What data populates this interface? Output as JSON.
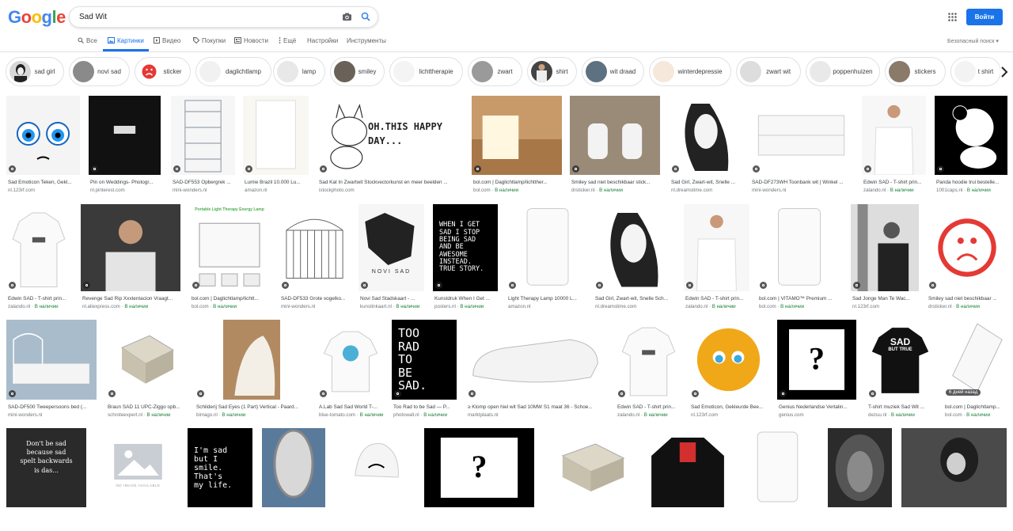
{
  "header": {
    "logo": "Google",
    "logo_colors": [
      "#4285f4",
      "#ea4335",
      "#fbbc05",
      "#4285f4",
      "#34a853",
      "#ea4335"
    ],
    "query": "Sad Wit",
    "signin_label": "Войти",
    "safesearch_label": "Безопасный поиск ▾"
  },
  "nav": {
    "tabs": [
      {
        "label": "Все",
        "icon": "search-icon"
      },
      {
        "label": "Картинки",
        "icon": "image-icon",
        "active": true
      },
      {
        "label": "Видео",
        "icon": "video-icon"
      },
      {
        "label": "Покупки",
        "icon": "tag-icon"
      },
      {
        "label": "Новости",
        "icon": "news-icon"
      },
      {
        "label": "Ещё",
        "icon": "more-icon"
      },
      {
        "label": "Настройки"
      },
      {
        "label": "Инструменты"
      }
    ]
  },
  "chips": [
    {
      "label": "sad girl"
    },
    {
      "label": "novi sad"
    },
    {
      "label": "sticker"
    },
    {
      "label": "daglichtlamp"
    },
    {
      "label": "lamp"
    },
    {
      "label": "smiley"
    },
    {
      "label": "lichttherapie"
    },
    {
      "label": "zwart"
    },
    {
      "label": "shirt"
    },
    {
      "label": "wit draad"
    },
    {
      "label": "winterdepressie"
    },
    {
      "label": "zwart wit"
    },
    {
      "label": "poppenhuizen"
    },
    {
      "label": "stickers"
    },
    {
      "label": "t shirt"
    }
  ],
  "grid": {
    "stock_label": "В наличии",
    "rows": [
      [
        {
          "cap": "Sad Emoticon Teken, Gekl...",
          "src": "nl.123rf.com",
          "stock": false
        },
        {
          "cap": "Pin on Weddings- Photogr...",
          "src": "nl.pinterest.com",
          "stock": false
        },
        {
          "cap": "SAD-DF553 Opbergrek ...",
          "src": "mini-wonders.nl",
          "stock": false
        },
        {
          "cap": "Lumie Brazil 10.000 Lu...",
          "src": "amazon.nl",
          "stock": false
        },
        {
          "cap": "Sad Kat In Zwartwit Stockvectorkunst en meer beelden ...",
          "src": "istockphoto.com",
          "stock": false,
          "sign": "OH.THIS HAPPY DAY..."
        },
        {
          "cap": "bol.com | Daglichtlamp/lichtther...",
          "src": "bol.com",
          "stock": true
        },
        {
          "cap": "Smiley sad niet beschikbaar stick...",
          "src": "drsticker.nl",
          "stock": true
        },
        {
          "cap": "Sad Girl, Zwart-wit, Snelle ...",
          "src": "nl.dreamstime.com",
          "stock": false
        },
        {
          "cap": "SAD-DF273WH Toonbank wit | Winkel ...",
          "src": "mini-wonders.nl",
          "stock": false
        },
        {
          "cap": "Edwin SAD - T-shirt prin...",
          "src": "zalando.nl",
          "stock": true
        },
        {
          "cap": "Panda hoodie trui bestelle...",
          "src": "1001caps.nl",
          "stock": true
        }
      ],
      [
        {
          "cap": "Edwin SAD - T-shirt prin...",
          "src": "zalando.nl",
          "stock": true
        },
        {
          "cap": "Revenge Sad Rip Xxxtentacion Vraagt...",
          "src": "nl.aliexpress.com",
          "stock": true
        },
        {
          "cap": "bol.com | Daglichtlamp/lichtt...",
          "src": "bol.com",
          "stock": true,
          "banner": "Portable Light Therapy Energy Lamp"
        },
        {
          "cap": "SAD-DF533 Grote vogelko...",
          "src": "mini-wonders.nl",
          "stock": false
        },
        {
          "cap": "Novi Sad Stadskaart - ...",
          "src": "kunstinkaart.nl",
          "stock": true,
          "maptitle": "NOVI SAD"
        },
        {
          "cap": "Kunstdruk When I Get ...",
          "src": "posters.nl",
          "stock": true,
          "poster": [
            "WHEN I GET",
            "SAD I STOP",
            "BEING SAD",
            "AND BE",
            "AWESOME",
            "INSTEAD.",
            "TRUE STORY."
          ]
        },
        {
          "cap": "Light Therapy Lamp 10000 L...",
          "src": "amazon.nl",
          "stock": false
        },
        {
          "cap": "Sad Girl, Zwart-wit, Snelle Sch...",
          "src": "nl.dreamstime.com",
          "stock": false
        },
        {
          "cap": "Edwin SAD - T-shirt prin...",
          "src": "zalando.nl",
          "stock": true
        },
        {
          "cap": "bol.com | VITAMO™ Premium ...",
          "src": "bol.com",
          "stock": true
        },
        {
          "cap": "Sad Jonge Man Te Wac...",
          "src": "nl.123rf.com",
          "stock": false
        },
        {
          "cap": "Smiley sad niet beschikbaar ...",
          "src": "drsticker.nl",
          "stock": true
        }
      ],
      [
        {
          "cap": "SAD-DF500 Tweepersoons bed (...",
          "src": "mini-wonders.nl",
          "stock": false
        },
        {
          "cap": "Braun SAD 11 UPC-Ziggo opb...",
          "src": "schroteexpert.nl",
          "stock": true
        },
        {
          "cap": "Schilderij Sad Eyes (1 Part) Vertical - Paard...",
          "src": "bimago.nl",
          "stock": true
        },
        {
          "cap": "A.Lab Sad Sad World T-...",
          "src": "blue-tomato.com",
          "stock": true
        },
        {
          "cap": "Too Rad to be Sad — P...",
          "src": "photowall.nl",
          "stock": true,
          "poster": [
            "TOO",
            "RAD",
            "TO",
            "BE",
            "SAD."
          ]
        },
        {
          "cap": "≥ Klomp open hiel wit Sad 10MW S1 maat 36 - Schoe...",
          "src": "marktplaats.nl",
          "stock": false
        },
        {
          "cap": "Edwin SAD - T-shirt prin...",
          "src": "zalando.nl",
          "stock": true
        },
        {
          "cap": "Sad Emoticon, Gekleurde Bee...",
          "src": "nl.123rf.com",
          "stock": false
        },
        {
          "cap": "Genius Nederlandse Vertalin...",
          "src": "genius.com",
          "stock": false
        },
        {
          "cap": "T-shirt muziek Sad Wit ...",
          "src": "dezuu.nl",
          "stock": true,
          "shirt": [
            "SAD",
            "BUT TRUE"
          ]
        },
        {
          "cap": "bol.com | Daglichtlamp...",
          "src": "bol.com",
          "stock": true,
          "ago": "6 дней назад"
        }
      ],
      [
        {
          "cap": "",
          "src": "",
          "stock": false,
          "board": [
            "Don't be sad",
            "because sad",
            "spelt backwards",
            "is das..."
          ]
        },
        {
          "cap": "",
          "src": "",
          "stock": false,
          "noimg": "NO IMAGE AVAILABLE"
        },
        {
          "cap": "",
          "src": "",
          "stock": false,
          "poster": [
            "I'm sad",
            "but I",
            "smile.",
            "That's",
            "my life."
          ]
        },
        {
          "cap": "",
          "src": "",
          "stock": false
        },
        {
          "cap": "",
          "src": "",
          "stock": false
        },
        {
          "cap": "",
          "src": "",
          "stock": false
        },
        {
          "cap": "",
          "src": "",
          "stock": false
        },
        {
          "cap": "",
          "src": "",
          "stock": false
        },
        {
          "cap": "",
          "src": "",
          "stock": false
        },
        {
          "cap": "",
          "src": "",
          "stock": false
        },
        {
          "cap": "",
          "src": "",
          "stock": false
        }
      ]
    ]
  }
}
